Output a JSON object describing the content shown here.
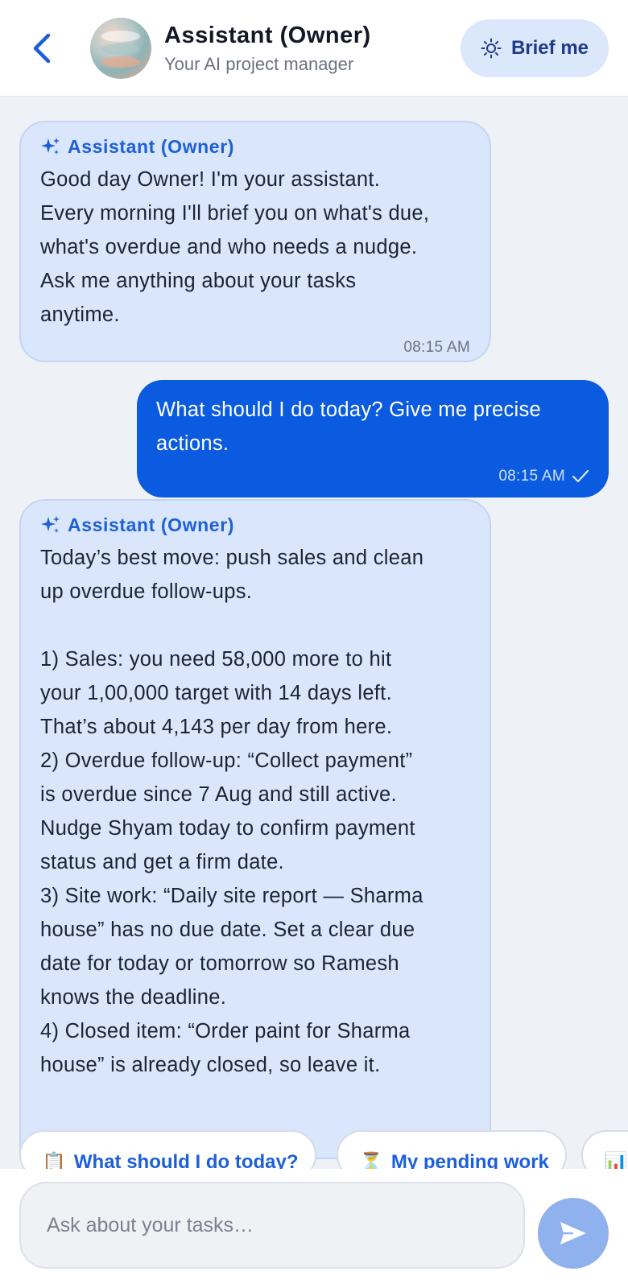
{
  "header": {
    "title": "Assistant (Owner)",
    "subtitle": "Your AI project manager",
    "brief_label": "Brief me"
  },
  "messages": [
    {
      "sender": "Assistant (Owner)",
      "text": "Good day Owner! I'm your assistant.\nEvery morning I'll brief you on what's due,\nwhat's overdue and who needs a nudge.\nAsk me anything about your tasks\nanytime.",
      "time": "08:15 AM"
    },
    {
      "text": "What should I do today? Give me precise\nactions.",
      "time": "08:15 AM"
    },
    {
      "sender": "Assistant (Owner)",
      "text": "Today’s best move: push sales and clean\nup overdue follow-ups.\n\n1) Sales: you need 58,000 more to hit\nyour 1,00,000 target with 14 days left.\nThat’s about 4,143 per day from here.\n2) Overdue follow-up: “Collect payment”\nis overdue since 7 Aug and still active.\nNudge Shyam today to confirm payment\nstatus and get a firm date.\n3) Site work: “Daily site report — Sharma\nhouse” has no due date. Set a clear due\ndate for today or tomorrow so Ramesh\nknows the deadline.\n4) Closed item: “Order paint for Sharma\nhouse” is already closed, so leave it."
    }
  ],
  "chips": [
    {
      "icon": "📋",
      "label": "What should I do today?"
    },
    {
      "icon": "⏳",
      "label": "My pending work"
    },
    {
      "icon": "📊",
      "label": ""
    }
  ],
  "composer": {
    "placeholder": "Ask about your tasks…"
  }
}
